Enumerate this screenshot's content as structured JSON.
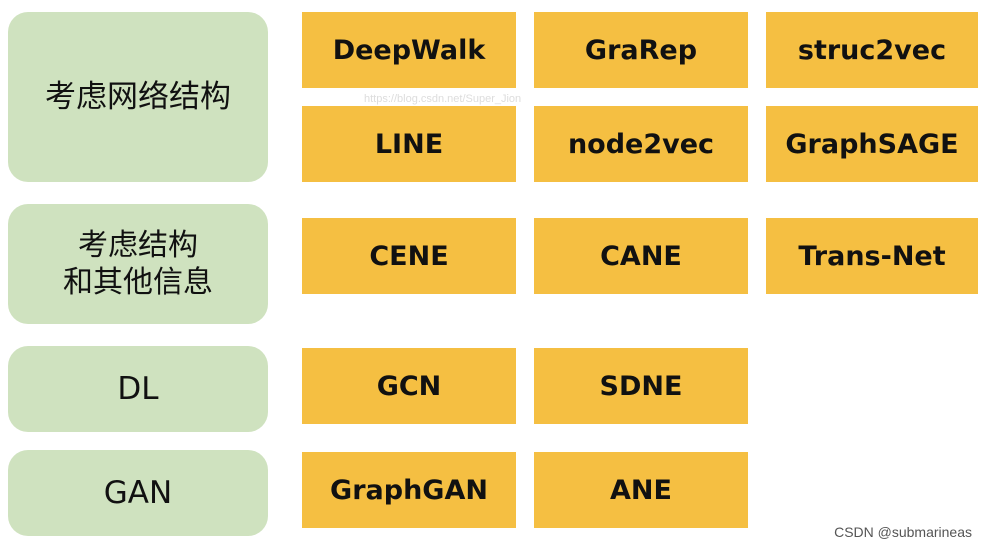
{
  "rows": [
    {
      "category": "考虑网络结构",
      "methods": [
        "DeepWalk",
        "GraRep",
        "struc2vec",
        "LINE",
        "node2vec",
        "GraphSAGE"
      ]
    },
    {
      "category": "考虑结构\n和其他信息",
      "methods": [
        "CENE",
        "CANE",
        "Trans-Net"
      ]
    },
    {
      "category": "DL",
      "methods": [
        "GCN",
        "SDNE"
      ]
    },
    {
      "category": "GAN",
      "methods": [
        "GraphGAN",
        "ANE"
      ]
    }
  ],
  "watermark": "https://blog.csdn.net/Super_Jion",
  "credit": "CSDN @submarineas",
  "colors": {
    "category": "#cfe2bf",
    "method": "#f5bf42"
  }
}
